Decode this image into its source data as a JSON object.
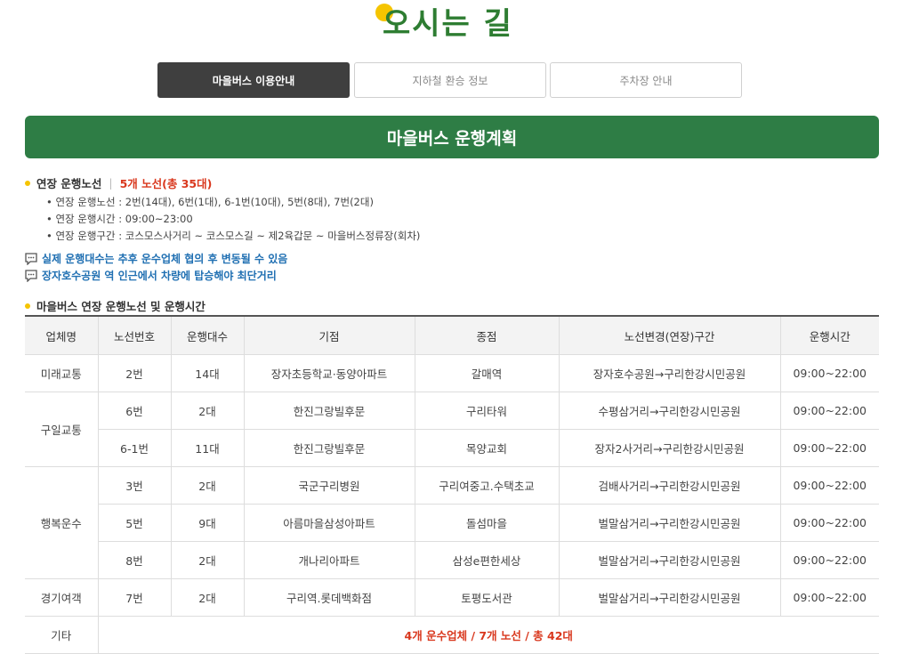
{
  "header": {
    "logo_text": "오시는 길"
  },
  "tabs": [
    {
      "label": "마을버스 이용안내",
      "active": true
    },
    {
      "label": "지하철 환승 정보",
      "active": false
    },
    {
      "label": "주차장 안내",
      "active": false
    }
  ],
  "banner": {
    "title": "마을버스 운행계획"
  },
  "extension": {
    "heading": "연장 운행노선",
    "summary": "5개 노선(총 35대)",
    "items": [
      "• 연장 운행노선 : 2번(14대), 6번(1대), 6-1번(10대), 5번(8대), 7번(2대)",
      "• 연장 운행시간 : 09:00~23:00",
      "• 연장 운행구간 : 코스모스사거리 ~ 코스모스길 ~ 제2육갑문 ~ 마을버스정류장(회차)"
    ]
  },
  "notes": [
    "실제 운행대수는 추후 운수업체 협의 후 변동될 수 있음",
    "장자호수공원 역 인근에서 차량에 탑승해야 최단거리"
  ],
  "table_section": {
    "heading": "마을버스 연장 운행노선 및 운행시간"
  },
  "table": {
    "headers": [
      "업체명",
      "노선번호",
      "운행대수",
      "기점",
      "종점",
      "노선변경(연장)구간",
      "운행시간"
    ],
    "companies": [
      "미래교통",
      "구일교통",
      "행복운수",
      "경기여객",
      "기타"
    ],
    "rows": [
      [
        "2번",
        "14대",
        "장자초등학교·동양아파트",
        "갈매역",
        "장자호수공원→구리한강시민공원",
        "09:00~22:00"
      ],
      [
        "6번",
        "2대",
        "한진그랑빌후문",
        "구리타워",
        "수평삼거리→구리한강시민공원",
        "09:00~22:00"
      ],
      [
        "6-1번",
        "11대",
        "한진그랑빌후문",
        "목양교회",
        "장자2사거리→구리한강시민공원",
        "09:00~22:00"
      ],
      [
        "3번",
        "2대",
        "국군구리병원",
        "구리여중고.수택초교",
        "검배사거리→구리한강시민공원",
        "09:00~22:00"
      ],
      [
        "5번",
        "9대",
        "아름마을삼성아파트",
        "돌섬마을",
        "벌말삼거리→구리한강시민공원",
        "09:00~22:00"
      ],
      [
        "8번",
        "2대",
        "개나리아파트",
        "삼성e편한세상",
        "벌말삼거리→구리한강시민공원",
        "09:00~22:00"
      ],
      [
        "7번",
        "2대",
        "구리역.롯데백화점",
        "토평도서관",
        "벌말삼거리→구리한강시민공원",
        "09:00~22:00"
      ]
    ],
    "total": "4개 운수업체 / 7개 노선 / 총 42대"
  },
  "colors": {
    "brand_green": "#2e7d45",
    "accent_yellow": "#f5c400",
    "highlight_red": "#d9381e",
    "note_blue": "#1f6fb2"
  },
  "icons": {
    "notes": "speech-bubble-icon",
    "bullets": "yellow-dot-icon"
  }
}
